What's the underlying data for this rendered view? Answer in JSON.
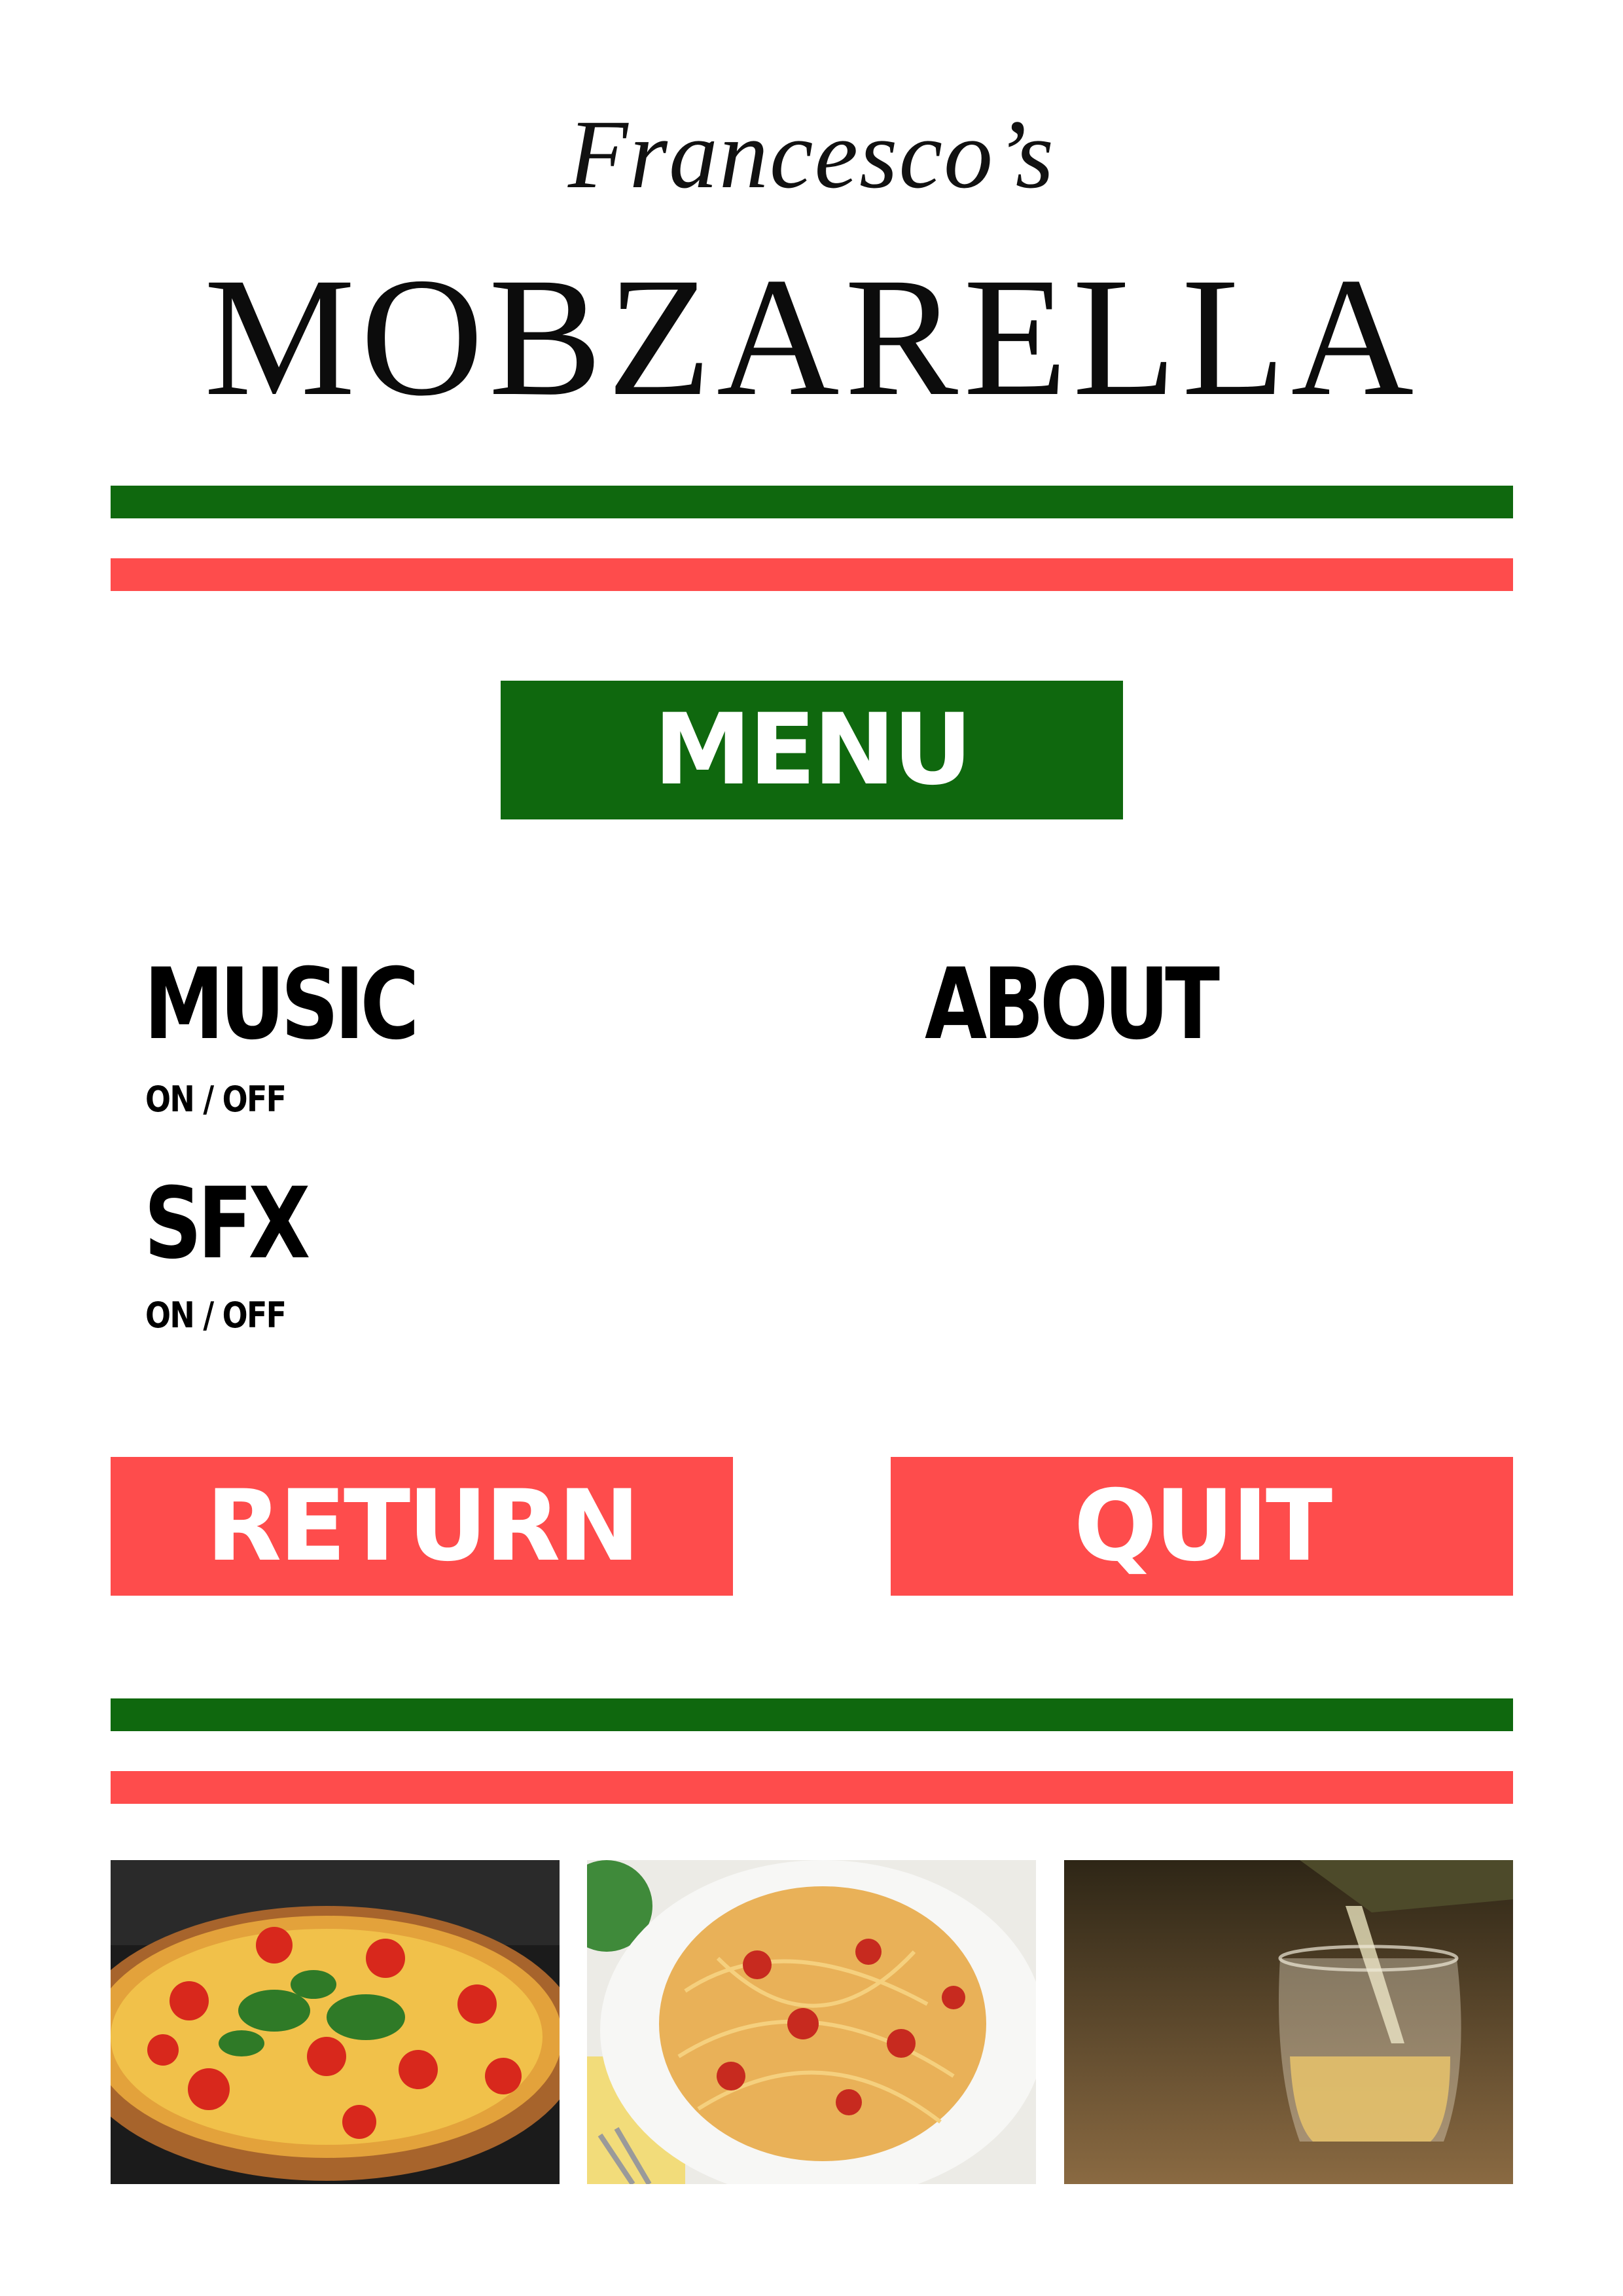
{
  "brand": {
    "script_name": "Francesco’s",
    "title": "MOBZARELLA"
  },
  "colors": {
    "green": "#0f680e",
    "red": "#fe4c4c",
    "text": "#0c0c0c",
    "background": "#ffffff"
  },
  "menu": {
    "header": "MENU",
    "options": {
      "music": {
        "label": "MUSIC",
        "toggle": "ON / OFF"
      },
      "sfx": {
        "label": "SFX",
        "toggle": "ON / OFF"
      },
      "about": {
        "label": "ABOUT"
      }
    },
    "buttons": {
      "return": "RETURN",
      "quit": "QUIT"
    }
  },
  "photos": [
    {
      "subject": "pizza-image"
    },
    {
      "subject": "spaghetti-image"
    },
    {
      "subject": "white-wine-image"
    }
  ]
}
